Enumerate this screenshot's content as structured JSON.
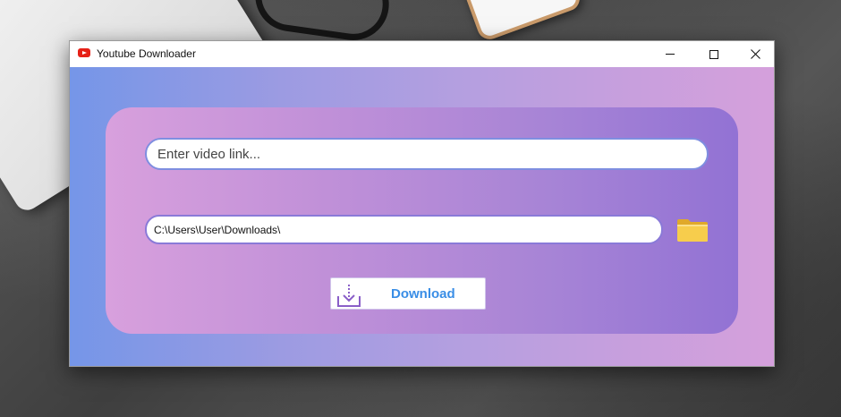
{
  "window": {
    "title": "Youtube Downloader",
    "controls": {
      "minimize_icon": "minimize-icon",
      "maximize_icon": "maximize-icon",
      "close_icon": "close-icon"
    }
  },
  "link_input": {
    "placeholder": "Enter video link...",
    "value": ""
  },
  "path_input": {
    "value": "C:\\Users\\User\\Downloads\\"
  },
  "folder_button": {
    "icon": "folder-icon"
  },
  "download_button": {
    "label": "Download",
    "icon": "download-icon"
  },
  "colors": {
    "app_icon": "#e62117",
    "download_label": "#3a8ee6",
    "folder": "#f5c542"
  }
}
